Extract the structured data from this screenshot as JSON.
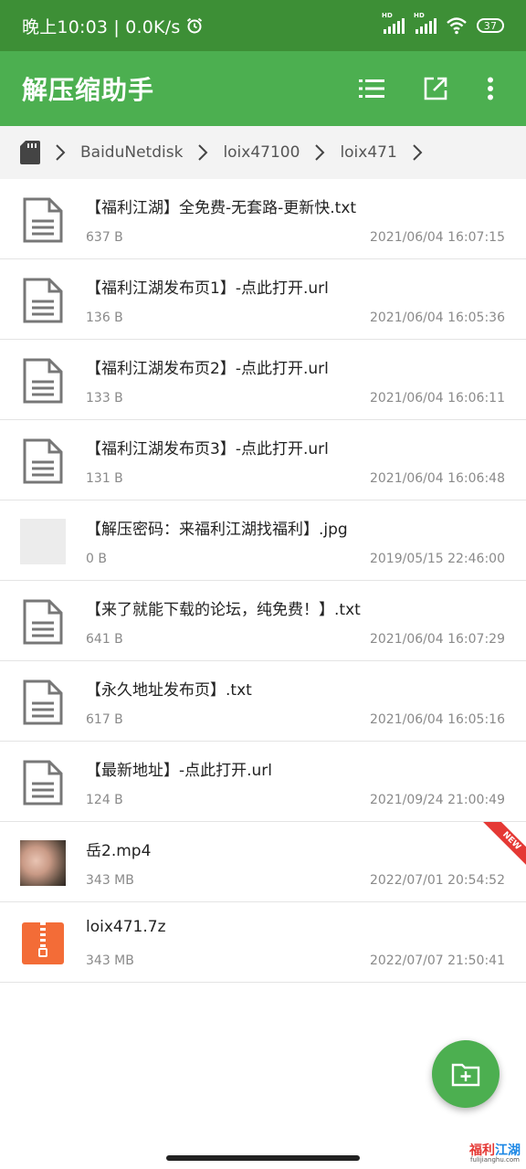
{
  "status_bar": {
    "time": "晚上10:03 | 0.0K/s",
    "battery": "37",
    "signal_label": "HD"
  },
  "app_bar": {
    "title": "解压缩助手",
    "icons": [
      "list-icon",
      "open-external-icon",
      "more-vert-icon"
    ]
  },
  "breadcrumb": {
    "root_icon": "sd-card-icon",
    "items": [
      "BaiduNetdisk",
      "loix47100",
      "loix471"
    ]
  },
  "files": [
    {
      "name": "【福利江湖】全免费-无套路-更新快.txt",
      "size": "637 B",
      "date": "2021/06/04 16:07:15",
      "icon": "document-icon"
    },
    {
      "name": "【福利江湖发布页1】-点此打开.url",
      "size": "136 B",
      "date": "2021/06/04 16:05:36",
      "icon": "document-icon"
    },
    {
      "name": "【福利江湖发布页2】-点此打开.url",
      "size": "133 B",
      "date": "2021/06/04 16:06:11",
      "icon": "document-icon"
    },
    {
      "name": "【福利江湖发布页3】-点此打开.url",
      "size": "131 B",
      "date": "2021/06/04 16:06:48",
      "icon": "document-icon"
    },
    {
      "name": "【解压密码：来福利江湖找福利】.jpg",
      "size": "0 B",
      "date": "2019/05/15 22:46:00",
      "icon": "image-thumbnail"
    },
    {
      "name": "【来了就能下载的论坛，纯免费！】.txt",
      "size": "641 B",
      "date": "2021/06/04 16:07:29",
      "icon": "document-icon"
    },
    {
      "name": "【永久地址发布页】.txt",
      "size": "617 B",
      "date": "2021/06/04 16:05:16",
      "icon": "document-icon"
    },
    {
      "name": "【最新地址】-点此打开.url",
      "size": "124 B",
      "date": "2021/09/24 21:00:49",
      "icon": "document-icon"
    },
    {
      "name": "岳2.mp4",
      "size": "343 MB",
      "date": "2022/07/01 20:54:52",
      "icon": "video-thumbnail",
      "badge": "NEW"
    },
    {
      "name": "loix471.7z",
      "size": "343 MB",
      "date": "2022/07/07 21:50:41",
      "icon": "archive-icon"
    }
  ],
  "fab": {
    "icon": "add-folder-icon"
  },
  "watermark": {
    "line1_a": "福利",
    "line1_b": "江湖",
    "line2": "fulijianghu.com"
  },
  "colors": {
    "status_bar": "#3d8f36",
    "app_bar": "#4caf50",
    "accent": "#4caf50",
    "archive": "#f36c37",
    "badge": "#e53935"
  }
}
